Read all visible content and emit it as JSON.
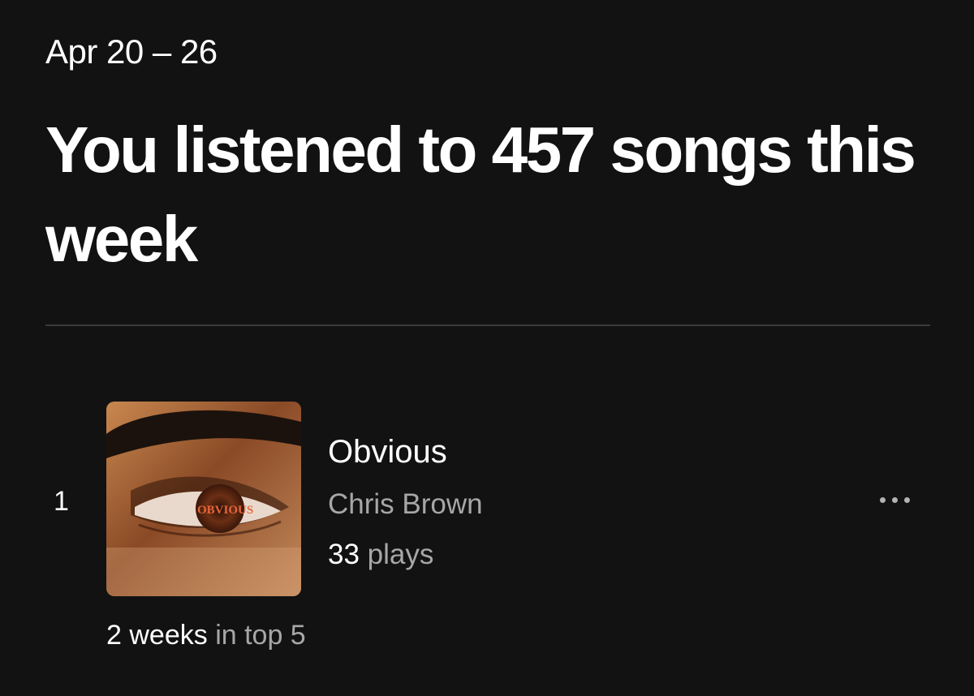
{
  "header": {
    "date_range": "Apr 20 – 26",
    "headline": "You listened to 457 songs this week"
  },
  "top_tracks": [
    {
      "rank": "1",
      "title": "Obvious",
      "artist": "Chris Brown",
      "plays_count": "33",
      "plays_suffix": "plays",
      "weeks_highlight": "2 weeks",
      "weeks_suffix": "in top 5",
      "cover_text": "OBVIOUS",
      "more_icon": "more-horizontal-icon"
    }
  ],
  "colors": {
    "background": "#121212",
    "primary_text": "#ffffff",
    "secondary_text": "#a7a7a7",
    "divider": "#3a3a3a"
  }
}
